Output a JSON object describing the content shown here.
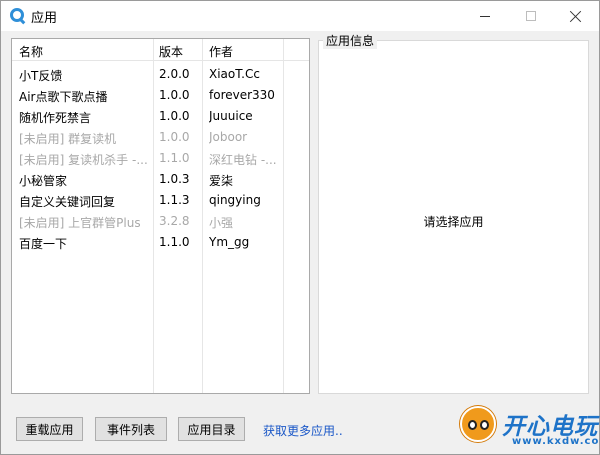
{
  "window": {
    "title": "应用",
    "icon": "app-logo-icon"
  },
  "list": {
    "headers": {
      "name": "名称",
      "version": "版本",
      "author": "作者"
    },
    "rows": [
      {
        "name": "小T反馈",
        "version": "2.0.0",
        "author": "XiaoT.Cc",
        "enabled": true
      },
      {
        "name": "Air点歌下歌点播",
        "version": "1.0.0",
        "author": "forever330",
        "enabled": true
      },
      {
        "name": "随机作死禁言",
        "version": "1.0.0",
        "author": "Juuuice",
        "enabled": true
      },
      {
        "name": "[未启用] 群复读机",
        "version": "1.0.0",
        "author": "Joboor",
        "enabled": false
      },
      {
        "name": "[未启用] 复读机杀手 -...",
        "version": "1.1.0",
        "author": "深红电钻 -...",
        "enabled": false
      },
      {
        "name": "小秘管家",
        "version": "1.0.3",
        "author": "爱柒",
        "enabled": true
      },
      {
        "name": "自定义关键词回复",
        "version": "1.1.3",
        "author": "qingying",
        "enabled": true
      },
      {
        "name": "[未启用] 上官群管Plus",
        "version": "3.2.8",
        "author": "小强",
        "enabled": false
      },
      {
        "name": "百度一下",
        "version": "1.1.0",
        "author": "Ym_gg",
        "enabled": true
      }
    ]
  },
  "info": {
    "legend": "应用信息",
    "placeholder": "请选择应用"
  },
  "footer": {
    "reload_label": "重载应用",
    "events_label": "事件列表",
    "dir_label": "应用目录",
    "more_link": "获取更多应用.."
  },
  "watermark": {
    "brand": "开心电玩",
    "url": "www.kxdw.com"
  },
  "colors": {
    "disabled_text": "#a8a8a8",
    "link": "#1a57c7",
    "logo_blue": "#1e73c8",
    "logo_orange": "#f09a1c"
  }
}
